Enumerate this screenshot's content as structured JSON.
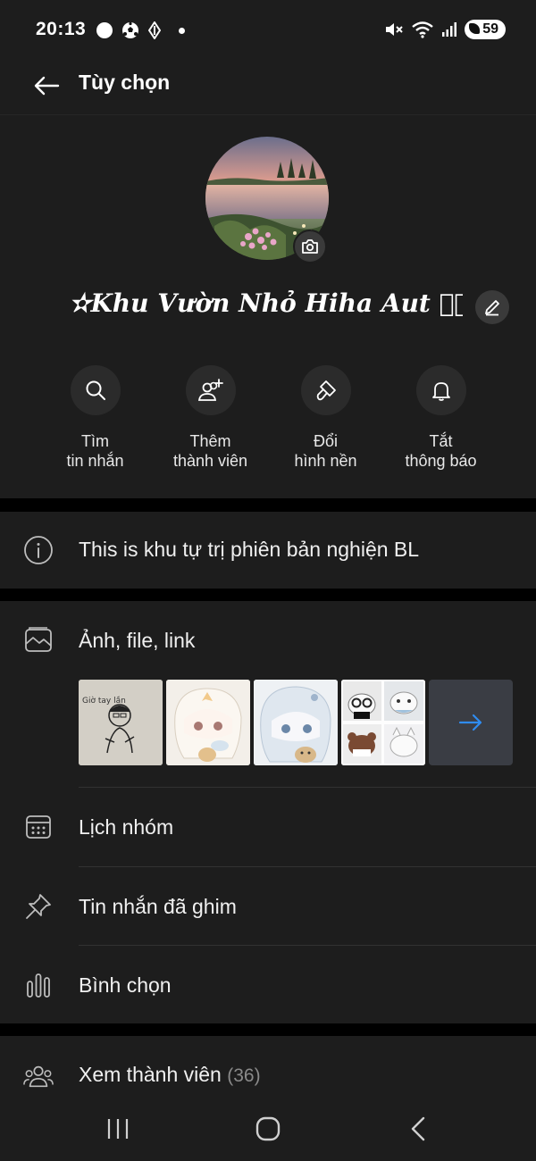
{
  "status_bar": {
    "time": "20:13",
    "battery": "59",
    "left_icons": [
      "circle-icon",
      "soccer-ball-icon",
      "diamond-icon",
      "dot-icon"
    ],
    "right_icons": [
      "mute-icon",
      "wifi-icon",
      "signal-icon",
      "battery-icon"
    ]
  },
  "app_bar": {
    "title": "Tùy chọn",
    "back_icon": "arrow-left-icon"
  },
  "group": {
    "name": "✫Khu Vườn Nhỏ Hiha Aut ͙⃟ ↬ ₊ ☯",
    "avatar_icon": "landscape-photo",
    "camera_icon": "camera-icon",
    "edit_icon": "pencil-icon"
  },
  "actions": [
    {
      "label": "Tìm\ntin nhắn",
      "icon": "search-icon"
    },
    {
      "label": "Thêm\nthành viên",
      "icon": "add-user-icon"
    },
    {
      "label": "Đổi\nhình nền",
      "icon": "paint-brush-icon"
    },
    {
      "label": "Tắt\nthông báo",
      "icon": "bell-icon"
    }
  ],
  "description": {
    "text": "This is khu tự trị phiên bản nghiện BL",
    "icon": "info-icon"
  },
  "media": {
    "label": "Ảnh, file, link",
    "icon": "images-icon",
    "more_icon": "arrow-right-icon",
    "thumb_note": "Giờ tay lần"
  },
  "menu": [
    {
      "label": "Lịch nhóm",
      "icon": "calendar-icon"
    },
    {
      "label": "Tin nhắn đã ghim",
      "icon": "pin-icon"
    },
    {
      "label": "Bình chọn",
      "icon": "poll-icon"
    }
  ],
  "members": {
    "label": "Xem thành viên",
    "count": "(36)",
    "icon": "group-icon"
  },
  "colors": {
    "background": "#000000",
    "panel": "#1d1d1d",
    "accent": "#2f8cf0",
    "text_muted": "#8a8a8a"
  },
  "nav": {
    "recent_icon": "recent-apps-icon",
    "home_icon": "home-icon",
    "back_icon": "nav-back-icon"
  }
}
